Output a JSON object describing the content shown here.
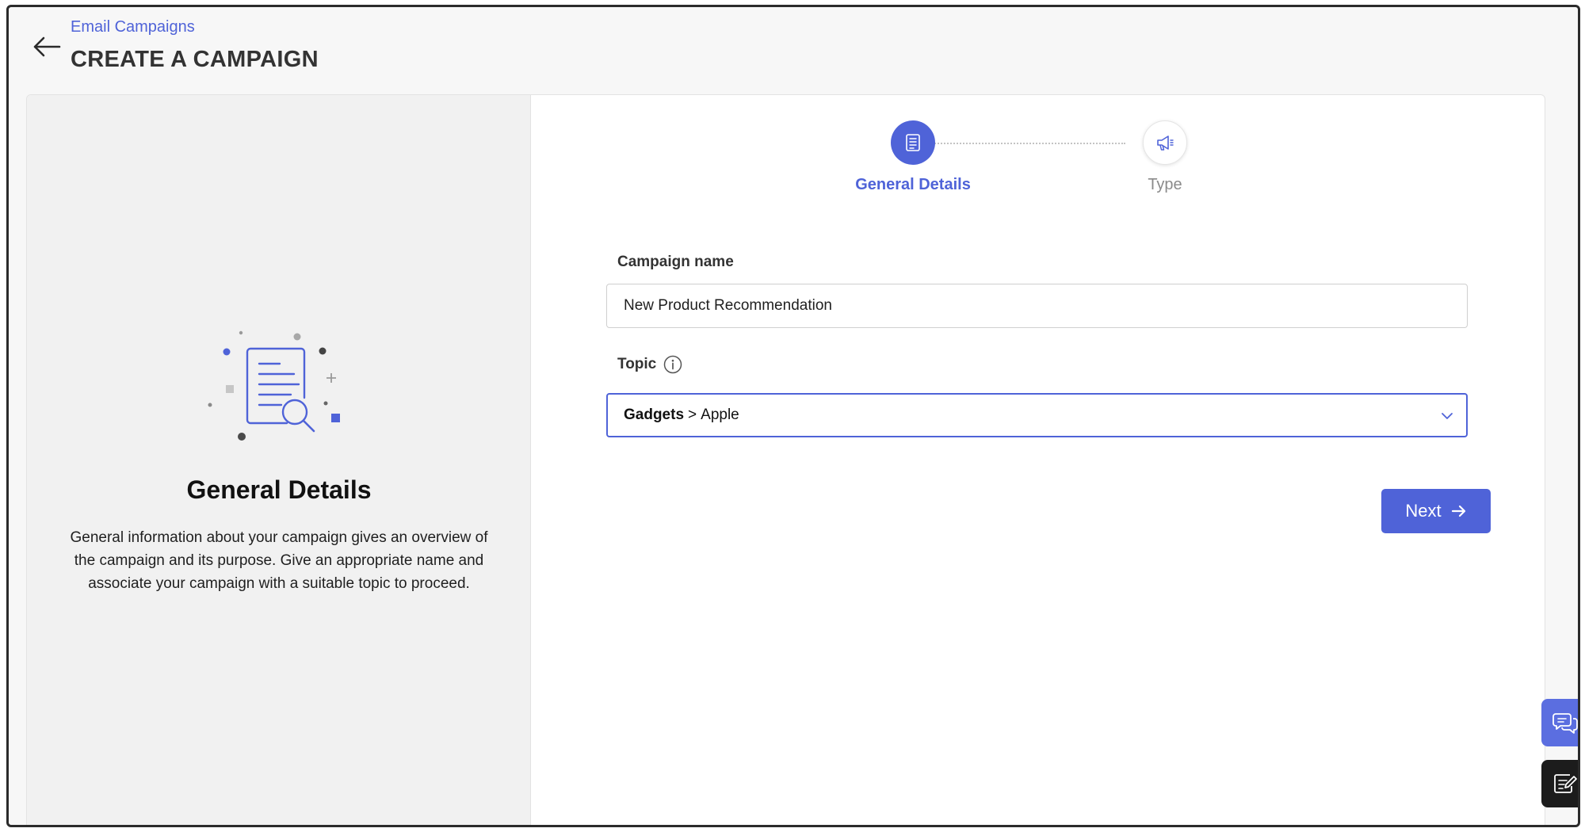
{
  "header": {
    "breadcrumb": "Email Campaigns",
    "title": "CREATE A CAMPAIGN",
    "back_icon": "arrow-left-icon"
  },
  "left_panel": {
    "illustration_icon": "document-search-icon",
    "heading": "General Details",
    "description": "General information about your campaign gives an overview of the campaign and its purpose. Give an appropriate name and associate your campaign with a suitable topic to proceed."
  },
  "stepper": {
    "steps": [
      {
        "label": "General Details",
        "icon": "list-document-icon",
        "state": "active"
      },
      {
        "label": "Type",
        "icon": "megaphone-icon",
        "state": "inactive"
      }
    ]
  },
  "form": {
    "campaign_name_label": "Campaign name",
    "campaign_name_value": "New Product Recommendation",
    "topic_label": "Topic",
    "topic_category": "Gadgets",
    "topic_separator": ">",
    "topic_subcategory": "Apple",
    "next_label": "Next"
  },
  "floating": {
    "chat_icon": "chat-bubbles-icon",
    "feedback_icon": "feedback-note-icon"
  },
  "colors": {
    "accent": "#4f63d8",
    "panel_bg": "#f1f1f1",
    "feedback_bg": "#1c1c1c"
  }
}
